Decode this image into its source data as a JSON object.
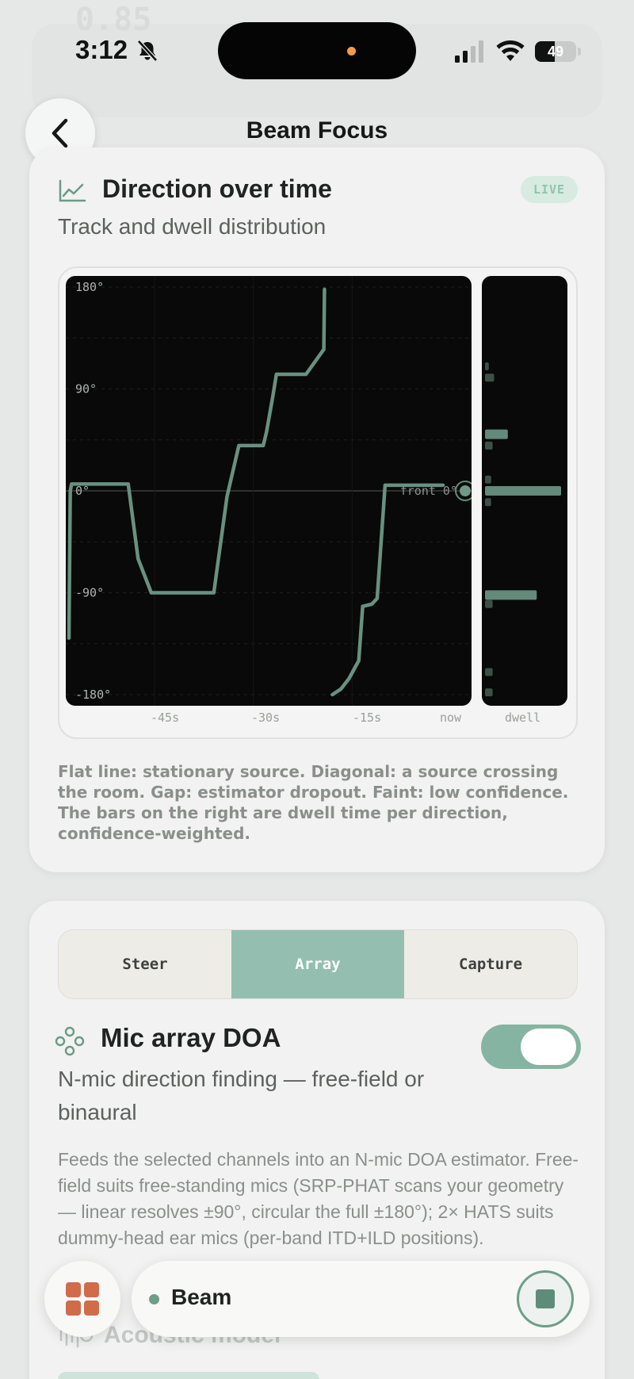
{
  "status_bar": {
    "time": "3:12",
    "battery_level": "49"
  },
  "nav": {
    "title": "Beam Focus"
  },
  "direction_card": {
    "title": "Direction over time",
    "subtitle": "Track and dwell distribution",
    "badge": "LIVE",
    "caption": "Flat line: stationary source. Diagonal: a source crossing the room. Gap: estimator dropout. Faint: low confidence. The bars on the right are dwell time per direction, confidence-weighted."
  },
  "chart_data": {
    "type": "line",
    "y_tick_labels": [
      "180°",
      "90°",
      "0°",
      "-90°",
      "-180°"
    ],
    "x_tick_labels": [
      "-45s",
      "-30s",
      "-15s",
      "now"
    ],
    "dwell_label": "dwell",
    "front_marker_label": "front 0°",
    "ylim": [
      -180,
      180
    ],
    "xlim": [
      -58,
      0
    ],
    "grid": true,
    "track": {
      "x": [
        -58,
        -57.8,
        -57.6,
        -55,
        -49,
        -47.5,
        -45.5,
        -43,
        -36,
        -35.3,
        -34,
        -32.2,
        -31.8,
        -28.5,
        -28,
        -27,
        -26.5,
        -22,
        -19.3,
        -19.2,
        -18,
        -16.7,
        -15.5,
        -14,
        -13.4,
        -12,
        -11.2,
        -10.6,
        -10,
        -7.8,
        -7.5,
        -3,
        -2,
        -1.2
      ],
      "y": [
        -130,
        0,
        6,
        6,
        6,
        -60,
        -90,
        -90,
        -90,
        -60,
        -5,
        40,
        40,
        40,
        52,
        85,
        103,
        103,
        125,
        178,
        -180,
        -175,
        -166,
        -150,
        -102,
        -100,
        -95,
        -45,
        5,
        5,
        5,
        5,
        5,
        5
      ]
    },
    "dwell": {
      "angles": [
        -178,
        -160,
        -100,
        -92,
        -10,
        0,
        10,
        40,
        50,
        100,
        110
      ],
      "weights": [
        0.1,
        0.1,
        0.1,
        0.68,
        0.08,
        1.0,
        0.08,
        0.1,
        0.3,
        0.12,
        0.05
      ]
    }
  },
  "array_card": {
    "tabs": [
      "Steer",
      "Array",
      "Capture"
    ],
    "active_tab": "Array",
    "title": "Mic array DOA",
    "subtitle": "N-mic direction finding — free-field or binaural",
    "toggle_on": true,
    "description": "Feeds the selected channels into an N-mic DOA estimator. Free-field suits free-standing mics (SRP-PHAT scans your geometry — linear resolves ±90°, circular the full ±180°); 2× HATS suits dummy-head ear mics (per-band ITD+ILD positions).",
    "next_section": "Acoustic model"
  },
  "bottom_bar": {
    "label": "Beam"
  },
  "colors": {
    "accent": "#94bfb0",
    "track": "#6e9987",
    "chart_bg": "#080908"
  }
}
